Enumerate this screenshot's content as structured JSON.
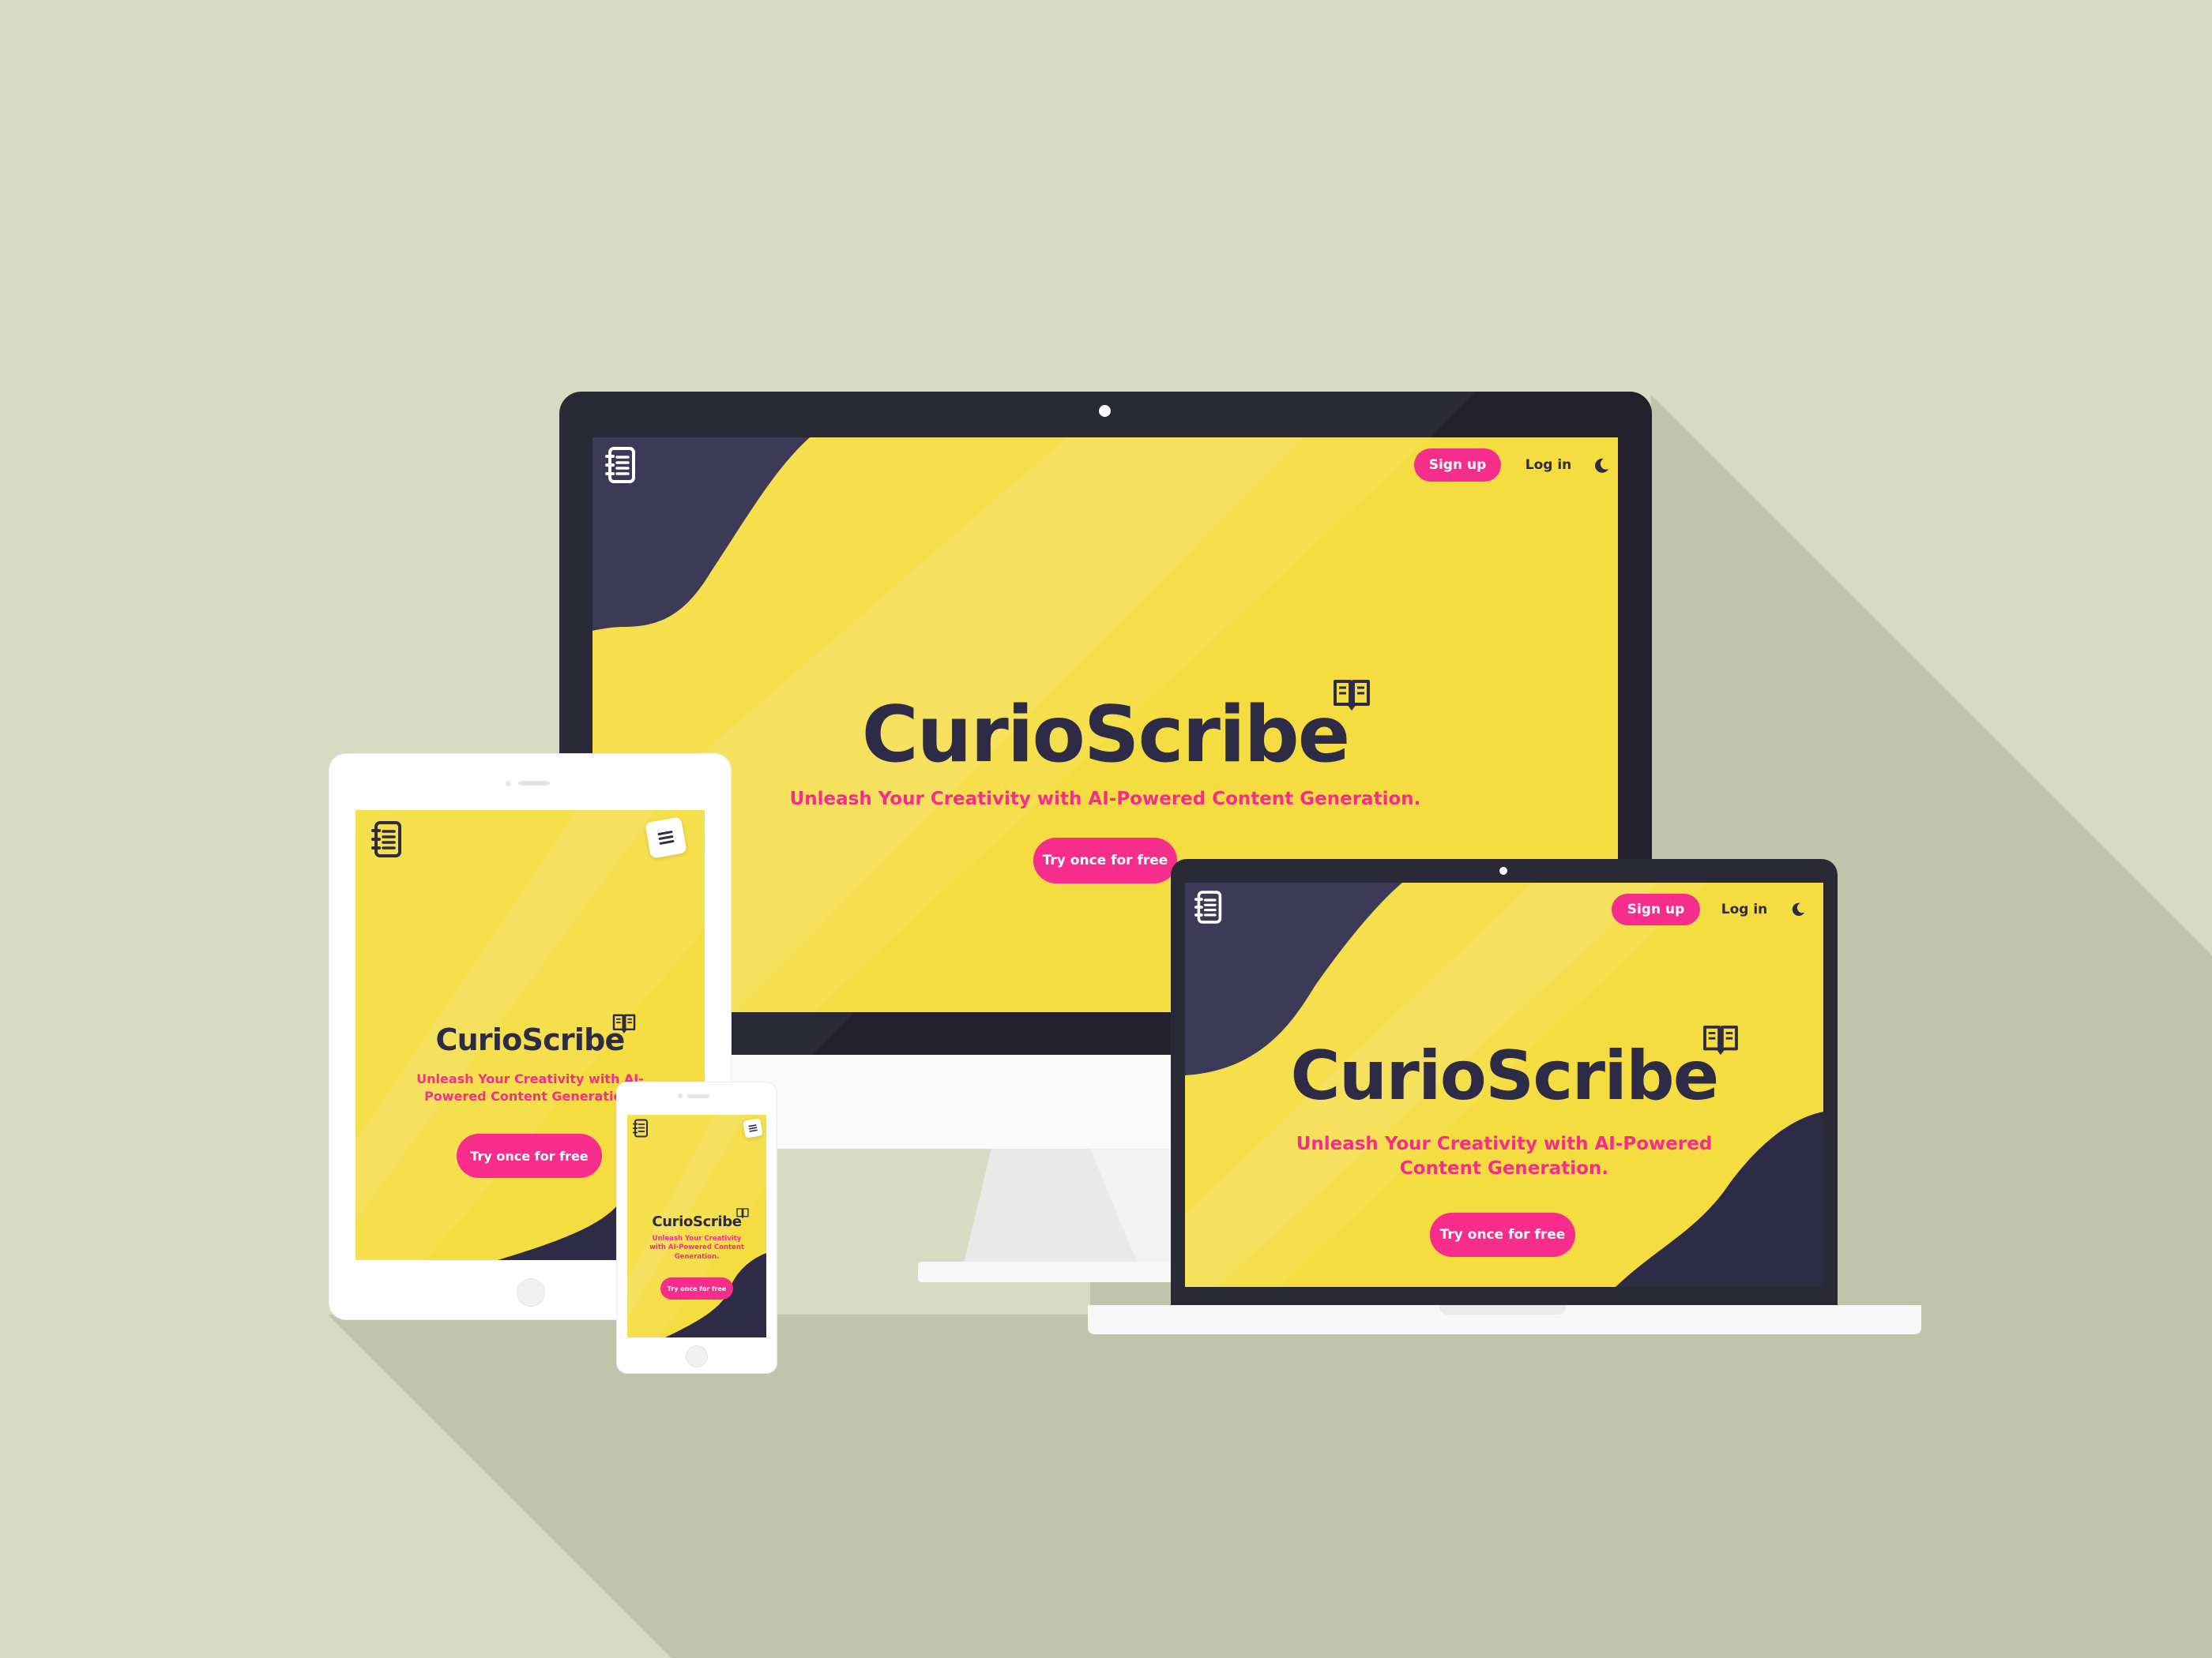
{
  "brand": {
    "name": "CurioScribe",
    "tagline": "Unleash Your Creativity with AI-Powered Content Generation.",
    "cta_label": "Try once for free"
  },
  "nav": {
    "signup_label": "Sign up",
    "login_label": "Log in"
  },
  "colors": {
    "background": "#d6dbc1",
    "screen_yellow": "#f5df4d",
    "navy": "#2d2b45",
    "accent_pink": "#f72d8c"
  },
  "icons": [
    "notebook-icon",
    "book-icon",
    "moon-icon",
    "menu-icon"
  ]
}
